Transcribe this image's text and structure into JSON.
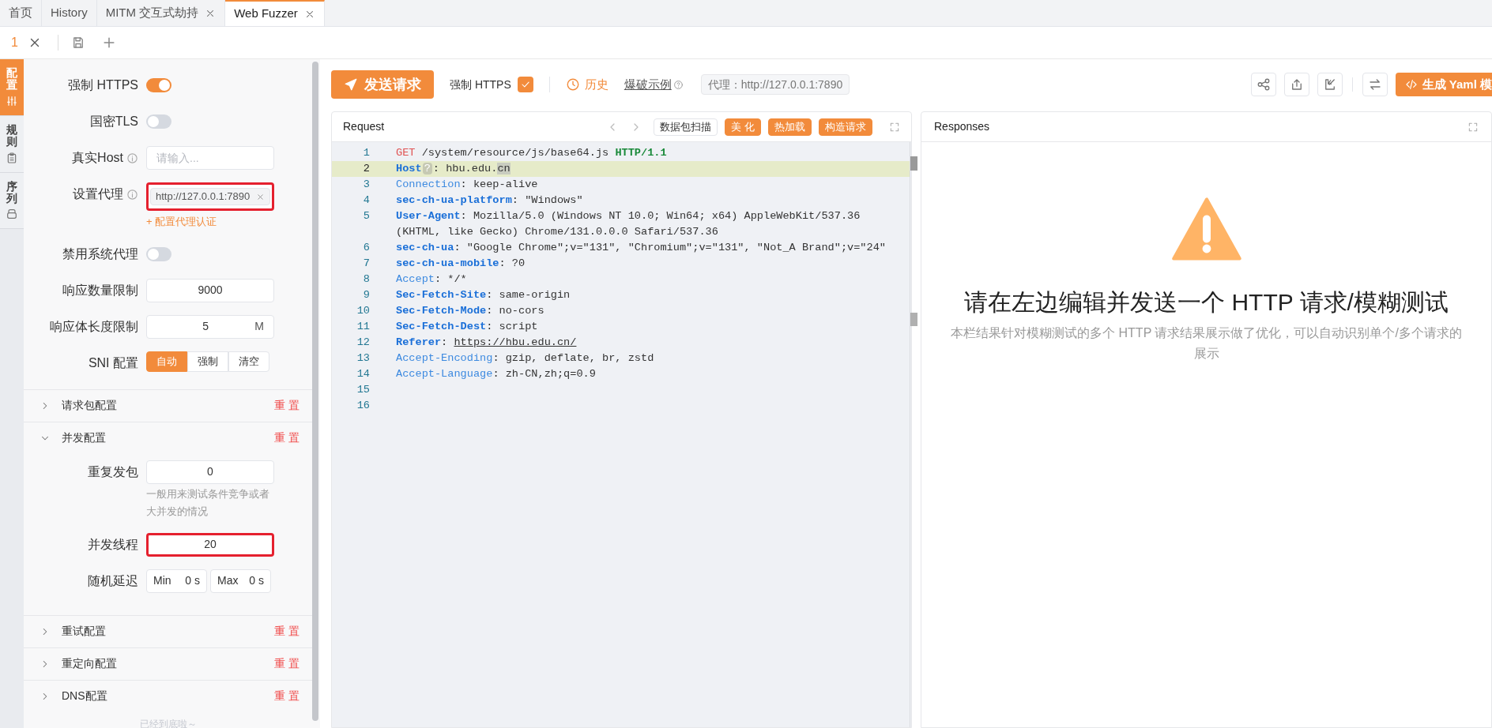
{
  "tabs": [
    {
      "label": "首页",
      "closable": false,
      "selected": false
    },
    {
      "label": "History",
      "closable": false,
      "selected": false
    },
    {
      "label": "MITM 交互式劫持",
      "closable": true,
      "selected": false
    },
    {
      "label": "Web Fuzzer",
      "closable": true,
      "selected": true
    }
  ],
  "sub_tabs": [
    {
      "label": "1",
      "selected": true
    }
  ],
  "side_tabs": [
    {
      "label": "配置",
      "selected": true
    },
    {
      "label": "规则",
      "selected": false
    },
    {
      "label": "序列",
      "selected": false
    }
  ],
  "config": {
    "fields": [
      {
        "kind": "switch",
        "label": "强制 HTTPS",
        "on": true
      },
      {
        "kind": "switch",
        "label": "国密TLS",
        "on": false
      },
      {
        "kind": "input",
        "label": "真实Host",
        "info": true,
        "placeholder": "请输入..."
      },
      {
        "kind": "tag",
        "label": "设置代理",
        "info": true,
        "tag": "http://127.0.0.1:7890",
        "highlighted": true,
        "link": "+ 配置代理认证"
      },
      {
        "kind": "switch",
        "label": "禁用系统代理",
        "on": false
      },
      {
        "kind": "input",
        "label": "响应数量限制",
        "value": "9000"
      },
      {
        "kind": "input",
        "label": "响应体长度限制",
        "value": "5",
        "suffix": "M"
      },
      {
        "kind": "segmented",
        "label": "SNI 配置",
        "options": [
          {
            "label": "自动",
            "selected": true
          },
          {
            "label": "强制",
            "selected": false
          },
          {
            "label": "清空",
            "selected": false
          }
        ]
      }
    ],
    "sections": [
      {
        "title": "请求包配置",
        "reset": "重 置",
        "expanded": false
      },
      {
        "title": "并发配置",
        "reset": "重 置",
        "expanded": true,
        "fields": [
          {
            "kind": "input",
            "label": "重复发包",
            "value": "0",
            "hint": "一般用来测试条件竞争或者大并发的情况"
          },
          {
            "kind": "input",
            "label": "并发线程",
            "value": "20",
            "highlighted": true
          },
          {
            "kind": "range",
            "label": "随机延迟",
            "min_label": "Min",
            "min_value": "0",
            "min_unit": "s",
            "max_label": "Max",
            "max_value": "0",
            "max_unit": "s"
          }
        ]
      },
      {
        "title": "重试配置",
        "reset": "重 置",
        "expanded": false
      },
      {
        "title": "重定向配置",
        "reset": "重 置",
        "expanded": false
      },
      {
        "title": "DNS配置",
        "reset": "重 置",
        "expanded": false
      }
    ],
    "footer": "已经到底啦～"
  },
  "toolbar": {
    "send": "发送请求",
    "https": {
      "label": "强制 HTTPS",
      "checked": true
    },
    "history": "历史",
    "example": "爆破示例",
    "proxy": "代理：http://127.0.0.1:7890",
    "yaml": "生成 Yaml 模"
  },
  "request": {
    "title": "Request",
    "buttons": [
      {
        "label": "数据包扫描",
        "kind": "outline"
      },
      {
        "label": "美 化",
        "kind": "filled"
      },
      {
        "label": "热加载",
        "kind": "filled"
      },
      {
        "label": "构造请求",
        "kind": "filled"
      }
    ],
    "lines": [
      {
        "number": "1",
        "highlighted": false,
        "tokens": [
          {
            "text": "GET",
            "kind": "method"
          },
          {
            "text": " /system/resource/js/base64.js ",
            "kind": "plain"
          },
          {
            "text": "HTTP/1.1",
            "kind": "version"
          }
        ]
      },
      {
        "number": "2",
        "highlighted": true,
        "tokens": [
          {
            "text": "Host",
            "kind": "strongkey"
          },
          {
            "text": "?",
            "kind": "badge"
          },
          {
            "text": ": hbu.edu.",
            "kind": "plain"
          },
          {
            "text": "cn",
            "kind": "marked"
          }
        ]
      },
      {
        "number": "3",
        "highlighted": false,
        "tokens": [
          {
            "text": "Connection",
            "kind": "key"
          },
          {
            "text": ": keep-alive",
            "kind": "plain"
          }
        ]
      },
      {
        "number": "4",
        "highlighted": false,
        "tokens": [
          {
            "text": "sec-ch-ua-platform",
            "kind": "strongkey"
          },
          {
            "text": ": \"Windows\"",
            "kind": "plain"
          }
        ]
      },
      {
        "number": "5",
        "highlighted": false,
        "tokens": [
          {
            "text": "User-Agent",
            "kind": "strongkey"
          },
          {
            "text": ": Mozilla/5.0 (Windows NT 10.0; Win64; x64) AppleWebKit/537.36 (KHTML, like Gecko) Chrome/131.0.0.0 Safari/537.36",
            "kind": "plain"
          }
        ]
      },
      {
        "number": "6",
        "highlighted": false,
        "tokens": [
          {
            "text": "sec-ch-ua",
            "kind": "strongkey"
          },
          {
            "text": ": \"Google Chrome\";v=\"131\", \"Chromium\";v=\"131\", \"Not_A Brand\";v=\"24\"",
            "kind": "plain"
          }
        ]
      },
      {
        "number": "7",
        "highlighted": false,
        "tokens": [
          {
            "text": "sec-ch-ua-mobile",
            "kind": "strongkey"
          },
          {
            "text": ": ?0",
            "kind": "plain"
          }
        ]
      },
      {
        "number": "8",
        "highlighted": false,
        "tokens": [
          {
            "text": "Accept",
            "kind": "key"
          },
          {
            "text": ": */*",
            "kind": "plain"
          }
        ]
      },
      {
        "number": "9",
        "highlighted": false,
        "tokens": [
          {
            "text": "Sec-Fetch-Site",
            "kind": "strongkey"
          },
          {
            "text": ": same-origin",
            "kind": "plain"
          }
        ]
      },
      {
        "number": "10",
        "highlighted": false,
        "tokens": [
          {
            "text": "Sec-Fetch-Mode",
            "kind": "strongkey"
          },
          {
            "text": ": no-cors",
            "kind": "plain"
          }
        ]
      },
      {
        "number": "11",
        "highlighted": false,
        "tokens": [
          {
            "text": "Sec-Fetch-Dest",
            "kind": "strongkey"
          },
          {
            "text": ": script",
            "kind": "plain"
          }
        ]
      },
      {
        "number": "12",
        "highlighted": false,
        "tokens": [
          {
            "text": "Referer",
            "kind": "strongkey"
          },
          {
            "text": ": ",
            "kind": "plain"
          },
          {
            "text": "https://hbu.edu.cn/",
            "kind": "link"
          }
        ]
      },
      {
        "number": "13",
        "highlighted": false,
        "tokens": [
          {
            "text": "Accept-Encoding",
            "kind": "key"
          },
          {
            "text": ": gzip, deflate, br, zstd",
            "kind": "plain"
          }
        ]
      },
      {
        "number": "14",
        "highlighted": false,
        "tokens": [
          {
            "text": "Accept-Language",
            "kind": "key"
          },
          {
            "text": ": zh-CN,zh;q=0.9",
            "kind": "plain"
          }
        ]
      },
      {
        "number": "15",
        "highlighted": false
      },
      {
        "number": "16",
        "highlighted": false
      }
    ]
  },
  "responses": {
    "title": "Responses",
    "message": "请在左边编辑并发送一个 HTTP 请求/模糊测试",
    "description": "本栏结果针对模糊测试的多个 HTTP 请求结果展示做了优化，可以自动识别单个/多个请求的展示"
  }
}
